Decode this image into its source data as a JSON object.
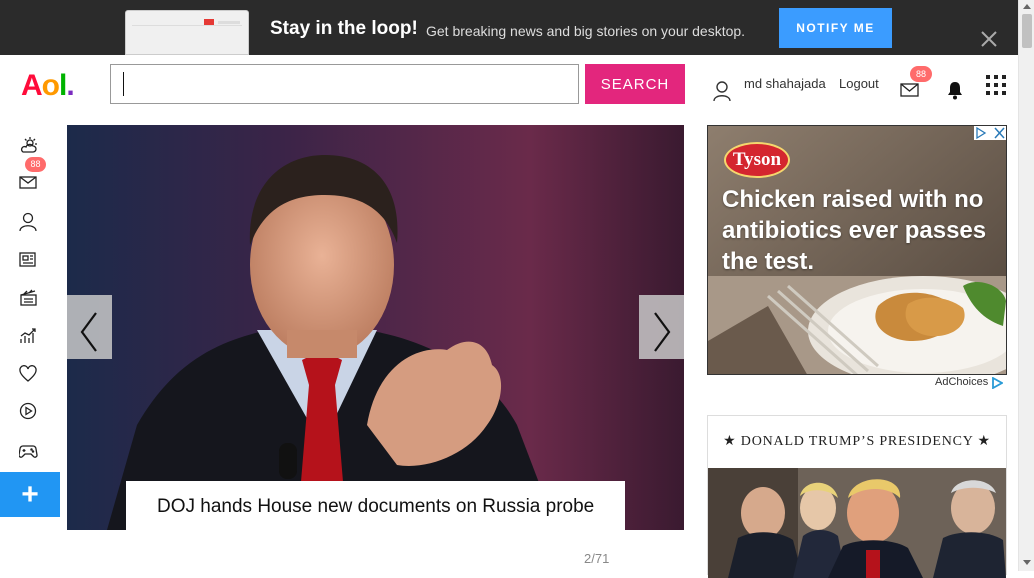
{
  "promo": {
    "title": "Stay in the loop!",
    "text": "Get breaking news and big stories on your desktop.",
    "notify_label": "NOTIFY ME",
    "close_glyph": "✕"
  },
  "header": {
    "logo": [
      "A",
      "o",
      "l",
      "."
    ],
    "logo_colors": [
      "#ff0b3a",
      "#ff9900",
      "#00b300",
      "#7b2cbf"
    ],
    "search_placeholder": "",
    "search_value": "",
    "search_label": "SEARCH",
    "username": "md shahajada",
    "logout_label": "Logout",
    "mail_count": "88"
  },
  "rail": {
    "items": [
      "weather-icon",
      "mail-icon",
      "user-icon",
      "news-icon",
      "entertainment-icon",
      "finance-icon",
      "lifestyle-icon",
      "video-icon",
      "games-icon"
    ],
    "mail_count": "88",
    "plus_label": "+"
  },
  "carousel": {
    "caption": "DOJ hands House new documents on Russia probe",
    "counter": "2/71"
  },
  "ad": {
    "brand": "Tyson",
    "headline": "Chicken raised with no antibiotics ever passes the test.",
    "adchoices_label": "AdChoices"
  },
  "presidency": {
    "title": "★ DONALD TRUMP’S PRESIDENCY ★"
  }
}
